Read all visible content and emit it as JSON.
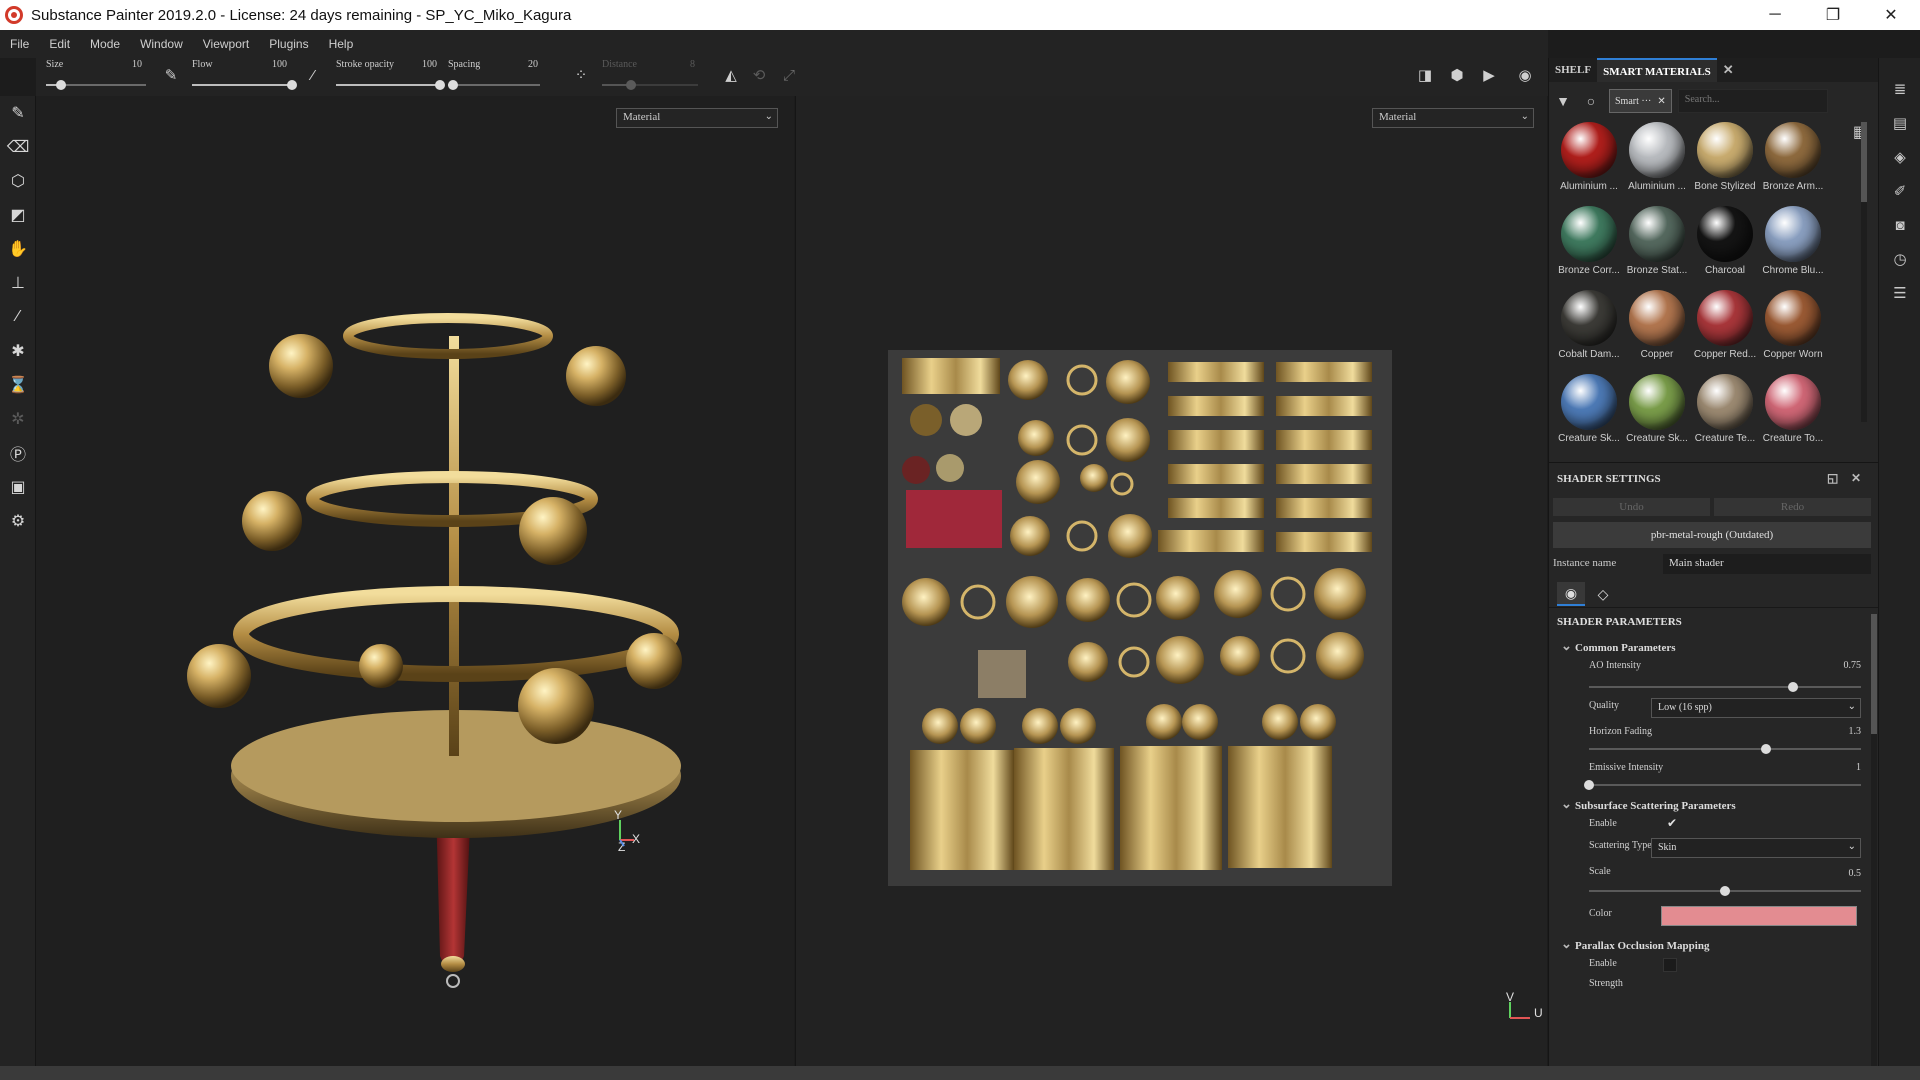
{
  "window": {
    "title": "Substance Painter 2019.2.0 - License: 24 days remaining - SP_YC_Miko_Kagura",
    "controls": [
      "─",
      "❐",
      "✕"
    ]
  },
  "menu": [
    "File",
    "Edit",
    "Mode",
    "Window",
    "Viewport",
    "Plugins",
    "Help"
  ],
  "toolbar": {
    "size": {
      "label": "Size",
      "value": "10",
      "level": 0.15
    },
    "flow": {
      "label": "Flow",
      "value": "100",
      "level": 1.0
    },
    "stroke_opacity": {
      "label": "Stroke opacity",
      "value": "100",
      "level": 1.0
    },
    "spacing": {
      "label": "Spacing",
      "value": "20",
      "level": 0.05
    },
    "distance": {
      "label": "Distance",
      "value": "8",
      "level": 0.3
    }
  },
  "viewport3d": {
    "mode_select": "Material",
    "axis": {
      "y": "Y",
      "x": "X",
      "z": "Z"
    }
  },
  "viewport2d": {
    "mode_select": "Material",
    "axis": {
      "v": "V",
      "u": "U"
    }
  },
  "shelf": {
    "tabs": [
      "SHELF",
      "SMART MATERIALS"
    ],
    "filter_chip": "Smart ···",
    "search_placeholder": "Search...",
    "materials": [
      {
        "name": "Aluminium ...",
        "color": "#b01f1c"
      },
      {
        "name": "Aluminium ...",
        "color": "#b9bcc0"
      },
      {
        "name": "Bone Stylized",
        "color": "#c9ac6f"
      },
      {
        "name": "Bronze Arm...",
        "color": "#8e6a3e"
      },
      {
        "name": "Bronze Corr...",
        "color": "#3f7a5f"
      },
      {
        "name": "Bronze Stat...",
        "color": "#55695f"
      },
      {
        "name": "Charcoal",
        "color": "#141414"
      },
      {
        "name": "Chrome Blu...",
        "color": "#8a9fc0"
      },
      {
        "name": "Cobalt Dam...",
        "color": "#3c3b37"
      },
      {
        "name": "Copper",
        "color": "#b2764f"
      },
      {
        "name": "Copper Red...",
        "color": "#a8363a"
      },
      {
        "name": "Copper Worn",
        "color": "#9a5a34"
      },
      {
        "name": "Creature Sk...",
        "color": "#4d7ab6"
      },
      {
        "name": "Creature Sk...",
        "color": "#7a9d4a"
      },
      {
        "name": "Creature Te...",
        "color": "#9c8a72"
      },
      {
        "name": "Creature To...",
        "color": "#d06776"
      }
    ]
  },
  "shader": {
    "title": "SHADER SETTINGS",
    "undo": "Undo",
    "redo": "Redo",
    "shader_name": "pbr-metal-rough (Outdated)",
    "instance_label": "Instance name",
    "instance_value": "Main shader",
    "params_title": "SHADER PARAMETERS",
    "common_title": "Common Parameters",
    "ao_intensity": {
      "label": "AO Intensity",
      "value": "0.75",
      "level": 0.75
    },
    "quality": {
      "label": "Quality",
      "value": "Low (16 spp)"
    },
    "horizon_fading": {
      "label": "Horizon Fading",
      "value": "1.3",
      "level": 0.65
    },
    "emissive_intensity": {
      "label": "Emissive Intensity",
      "value": "1",
      "level": 0.0
    },
    "sss_title": "Subsurface Scattering Parameters",
    "sss_enable": {
      "label": "Enable",
      "checked": true
    },
    "scattering_type": {
      "label": "Scattering Type",
      "value": "Skin"
    },
    "scale": {
      "label": "Scale",
      "value": "0.5",
      "level": 0.5
    },
    "color": {
      "label": "Color",
      "hex": "#e38c91"
    },
    "pom_title": "Parallax Occlusion Mapping",
    "pom_enable": {
      "label": "Enable",
      "checked": false
    },
    "strength_label": "Strength"
  }
}
